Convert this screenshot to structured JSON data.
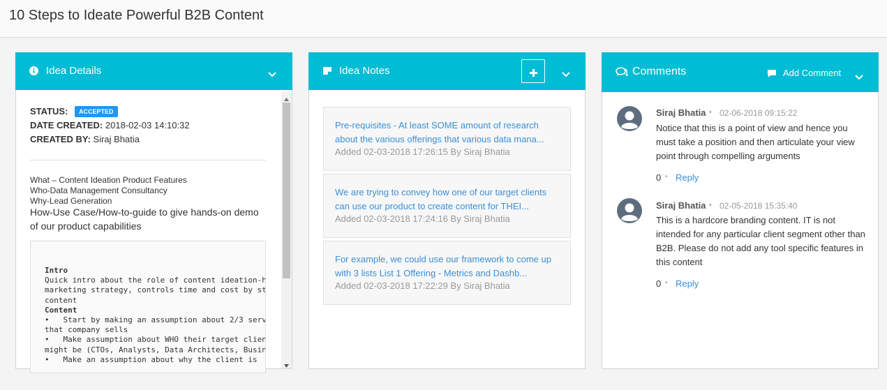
{
  "page": {
    "title": "10 Steps to Ideate Powerful B2B Content"
  },
  "colors": {
    "header_bg": "#00bcd4",
    "badge": "#2196f3",
    "link": "#3a8fd6"
  },
  "idea_details": {
    "icon": "info-icon",
    "title": "Idea Details",
    "status_label": "STATUS:",
    "status_value": "ACCEPTED",
    "date_label": "DATE CREATED:",
    "date_value": "2018-02-03 14:10:32",
    "created_label": "CREATED BY:",
    "created_value": "Siraj Bhatia",
    "lines": [
      "What – Content Ideation Product Features",
      "Who-Data Management Consultancy",
      "Why-Lead Generation"
    ],
    "how": "How-Use Case/How-to-guide to give hands-on demo of our product capabilities",
    "code": {
      "intro_heading": "Intro",
      "intro_text": "Quick intro about the role of content ideation-h\nmarketing strategy, controls time and cost by st\ncontent",
      "content_heading": "Content",
      "content_text": "•   Start by making an assumption about 2/3 serv\nthat company sells\n•   Make assumption about WHO their target client\nmight be (CTOs, Analysts, Data Architects, Busin\n•   Make an assumption about why the client is\n    "
    }
  },
  "idea_notes": {
    "icon": "note-icon",
    "title": "Idea Notes",
    "add_icon": "plus-icon",
    "notes": [
      {
        "text": "Pre-requisites - At least SOME amount of research about the various offerings that various data mana...",
        "meta": "Added 02-03-2018 17:26:15 By Siraj Bhatia"
      },
      {
        "text": "We are trying to convey how one of our target clients can use our product to create content for THEI...",
        "meta": "Added 02-03-2018 17:24:16 By Siraj Bhatia"
      },
      {
        "text": "For example, we could use our framework to come up with 3 lists List 1 Offering - Metrics and Dashb...",
        "meta": "Added 02-03-2018 17:22:29 By Siraj Bhatia"
      }
    ]
  },
  "comments": {
    "icon": "comments-icon",
    "title": "Comments",
    "add_label": "Add Comment",
    "add_icon": "comment-icon",
    "items": [
      {
        "author": "Siraj Bhatia",
        "date": "02-06-2018 09:15:22",
        "body": "Notice that this is a point of view and hence you must take a position and then articulate your view point through compelling arguments",
        "count": "0",
        "reply": "Reply"
      },
      {
        "author": "Siraj Bhatia",
        "date": "02-05-2018 15:35:40",
        "body": "This is a hardcore branding content. IT is not intended for any particular client segment other than B2B. Please do not add any tool specific features in this content",
        "count": "0",
        "reply": "Reply"
      }
    ]
  }
}
